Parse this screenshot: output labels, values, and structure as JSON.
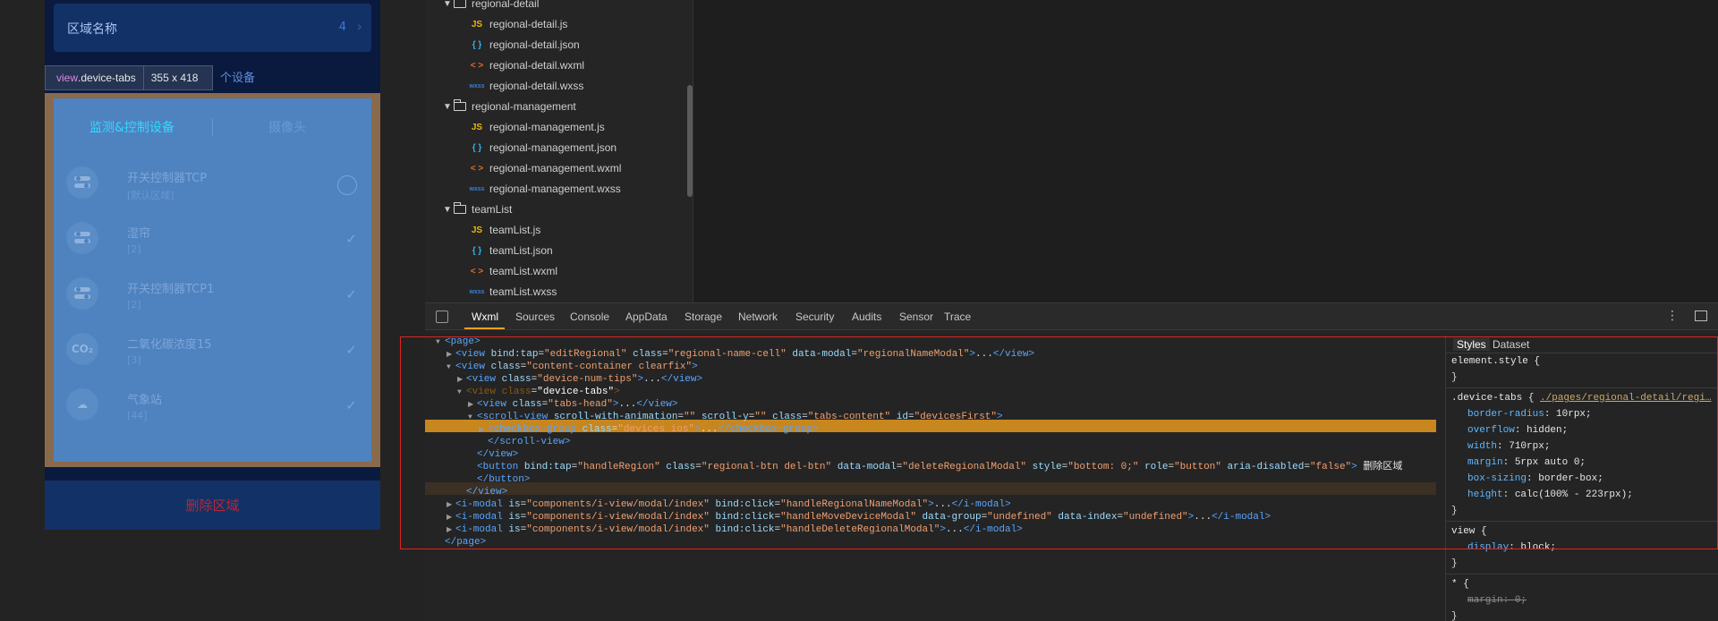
{
  "simulator": {
    "region_label": "区域名称",
    "region_count": "4",
    "tooltip": {
      "tag": "view",
      "class": ".device-tabs",
      "size": "355 x 418"
    },
    "num_tip": "个设备",
    "tabs": [
      "监测&控制设备",
      "摄像头"
    ],
    "devices": [
      {
        "name": "开关控制器TCP",
        "sub": "[默认区域]",
        "icon": "toggle",
        "state": "unchecked"
      },
      {
        "name": "湿帘",
        "sub": "[2]",
        "icon": "toggle",
        "state": "checked"
      },
      {
        "name": "开关控制器TCP1",
        "sub": "[2]",
        "icon": "toggle",
        "state": "checked"
      },
      {
        "name": "二氧化碳浓度15",
        "sub": "[3]",
        "icon": "CO₂",
        "state": "checked"
      },
      {
        "name": "气象站",
        "sub": "[44]",
        "icon": "weather",
        "state": "checked"
      }
    ],
    "delete_label": "删除区域"
  },
  "file_tree": {
    "rows": [
      {
        "kind": "folder",
        "name": "regional-detail",
        "indent": 1
      },
      {
        "kind": "js",
        "name": "regional-detail.js",
        "indent": 2
      },
      {
        "kind": "json",
        "name": "regional-detail.json",
        "indent": 2
      },
      {
        "kind": "wxml",
        "name": "regional-detail.wxml",
        "indent": 2
      },
      {
        "kind": "wxss",
        "name": "regional-detail.wxss",
        "indent": 2
      },
      {
        "kind": "folder",
        "name": "regional-management",
        "indent": 1
      },
      {
        "kind": "js",
        "name": "regional-management.js",
        "indent": 2
      },
      {
        "kind": "json",
        "name": "regional-management.json",
        "indent": 2
      },
      {
        "kind": "wxml",
        "name": "regional-management.wxml",
        "indent": 2
      },
      {
        "kind": "wxss",
        "name": "regional-management.wxss",
        "indent": 2
      },
      {
        "kind": "folder",
        "name": "teamList",
        "indent": 1
      },
      {
        "kind": "js",
        "name": "teamList.js",
        "indent": 2
      },
      {
        "kind": "json",
        "name": "teamList.json",
        "indent": 2
      },
      {
        "kind": "wxml",
        "name": "teamList.wxml",
        "indent": 2
      },
      {
        "kind": "wxss",
        "name": "teamList.wxss",
        "indent": 2
      }
    ],
    "icons": {
      "js": "JS",
      "json": "{ }",
      "wxml": "< >",
      "wxss": "wxss"
    }
  },
  "devtools": {
    "tabs": [
      "Wxml",
      "Sources",
      "Console",
      "AppData",
      "Storage",
      "Network",
      "Security",
      "Audits",
      "Sensor",
      "Trace"
    ],
    "active_tab": "Wxml",
    "more_icon": "⋮",
    "wxml_lines": [
      {
        "indent": 0,
        "arrow": "▼",
        "html": "<span class='tg'>&lt;page&gt;</span>"
      },
      {
        "indent": 1,
        "arrow": "▶",
        "html": "<span class='tg'>&lt;view</span> <span class='at'>bind:tap</span>=<span class='av'>\"editRegional\"</span> <span class='at'>class</span>=<span class='av'>\"regional-name-cell\"</span> <span class='at'>data-modal</span>=<span class='av'>\"regionalNameModal\"</span><span class='tg'>&gt;</span>...<span class='tg'>&lt;/view&gt;</span>"
      },
      {
        "indent": 1,
        "arrow": "▼",
        "html": "<span class='tg'>&lt;view</span> <span class='at'>class</span>=<span class='av'>\"content-container clearfix\"</span><span class='tg'>&gt;</span>"
      },
      {
        "indent": 2,
        "arrow": "▶",
        "html": "<span class='tg'>&lt;view</span> <span class='at'>class</span>=<span class='av'>\"device-num-tips\"</span><span class='tg'>&gt;</span>...<span class='tg'>&lt;/view&gt;</span>"
      },
      {
        "indent": 2,
        "arrow": "▼",
        "html": "<span style='color:#8a5a10'>&lt;view</span> <span style='color:#8a5a10'>class</span>=<span style='color:#fff'>\"device-tabs\"</span><span style='color:#8a5a10'>&gt;</span>"
      },
      {
        "indent": 3,
        "arrow": "▶",
        "html": "<span class='tg'>&lt;view</span> <span class='at'>class</span>=<span class='av'>\"tabs-head\"</span><span class='tg'>&gt;</span>...<span class='tg'>&lt;/view&gt;</span>"
      },
      {
        "indent": 3,
        "arrow": "▼",
        "html": "<span class='tg'>&lt;scroll-view</span> <span class='at'>scroll-with-animation</span>=<span class='av'>\"\"</span> <span class='at'>scroll-y</span>=<span class='av'>\"\"</span> <span class='at'>class</span>=<span class='av'>\"tabs-content\"</span> <span class='at'>id</span>=<span class='av'>\"devicesFirst\"</span><span class='tg'>&gt;</span>"
      },
      {
        "indent": 4,
        "arrow": "▶",
        "html": "<span class='tg'>&lt;checkbox-group</span> <span class='at'>class</span>=<span class='av'>\"devices ios\"</span><span class='tg'>&gt;</span>...<span class='tg'>&lt;/checkbox-group&gt;</span>"
      },
      {
        "indent": 4,
        "arrow": "",
        "html": "<span class='tg'>&lt;/scroll-view&gt;</span>"
      },
      {
        "indent": 3,
        "arrow": "",
        "html": "<span class='tg'>&lt;/view&gt;</span>"
      },
      {
        "indent": 3,
        "arrow": "",
        "html": "<span class='tg'>&lt;button</span> <span class='at'>bind:tap</span>=<span class='av'>\"handleRegion\"</span> <span class='at'>class</span>=<span class='av'>\"regional-btn del-btn\"</span> <span class='at'>data-modal</span>=<span class='av'>\"deleteRegionalModal\"</span> <span class='at'>style</span>=<span class='av'>\"bottom: 0;\"</span> <span class='at'>role</span>=<span class='av'>\"button\"</span> <span class='at'>aria-disabled</span>=<span class='av'>\"false\"</span><span class='tg'>&gt;</span> <span class='tx'>删除区域</span>"
      },
      {
        "indent": 3,
        "arrow": "",
        "html": "<span class='tg'>&lt;/button&gt;</span>"
      },
      {
        "indent": 2,
        "arrow": "",
        "html": "<span class='tg'>&lt;/view&gt;</span>"
      },
      {
        "indent": 1,
        "arrow": "▶",
        "html": "<span class='tg'>&lt;i-modal</span> <span class='at'>is</span>=<span class='av'>\"components/i-view/modal/index\"</span> <span class='at'>bind:click</span>=<span class='av'>\"handleRegionalNameModal\"</span><span class='tg'>&gt;</span>...<span class='tg'>&lt;/i-modal&gt;</span>"
      },
      {
        "indent": 1,
        "arrow": "▶",
        "html": "<span class='tg'>&lt;i-modal</span> <span class='at'>is</span>=<span class='av'>\"components/i-view/modal/index\"</span> <span class='at'>bind:click</span>=<span class='av'>\"handleMoveDeviceModal\"</span> <span class='at'>data-group</span>=<span class='av'>\"undefined\"</span> <span class='at'>data-index</span>=<span class='av'>\"undefined\"</span><span class='tg'>&gt;</span>...<span class='tg'>&lt;/i-modal&gt;</span>"
      },
      {
        "indent": 1,
        "arrow": "▶",
        "html": "<span class='tg'>&lt;i-modal</span> <span class='at'>is</span>=<span class='av'>\"components/i-view/modal/index\"</span> <span class='at'>bind:click</span>=<span class='av'>\"handleDeleteRegionalModal\"</span><span class='tg'>&gt;</span>...<span class='tg'>&lt;/i-modal&gt;</span>"
      },
      {
        "indent": 0,
        "arrow": "",
        "html": "<span class='tg'>&lt;/page&gt;</span>"
      }
    ],
    "styles_tabs": [
      "Styles",
      "Dataset"
    ],
    "element_style": "element.style {",
    "rule1": {
      "selector": ".device-tabs {",
      "source": "./pages/regional-detail/regi…",
      "props": [
        [
          "border-radius",
          "10rpx;"
        ],
        [
          "overflow",
          "hidden;"
        ],
        [
          "width",
          "710rpx;"
        ],
        [
          "margin",
          "5rpx auto 0;"
        ],
        [
          "box-sizing",
          "border-box;"
        ],
        [
          "height",
          "calc(100% - 223rpx);"
        ]
      ]
    },
    "rule2": {
      "selector": "view {",
      "props": [
        [
          "display",
          "block;"
        ]
      ]
    },
    "rule3": {
      "selector": "* {",
      "props": [
        [
          "margin",
          "0;"
        ]
      ]
    },
    "close_brace": "}"
  }
}
